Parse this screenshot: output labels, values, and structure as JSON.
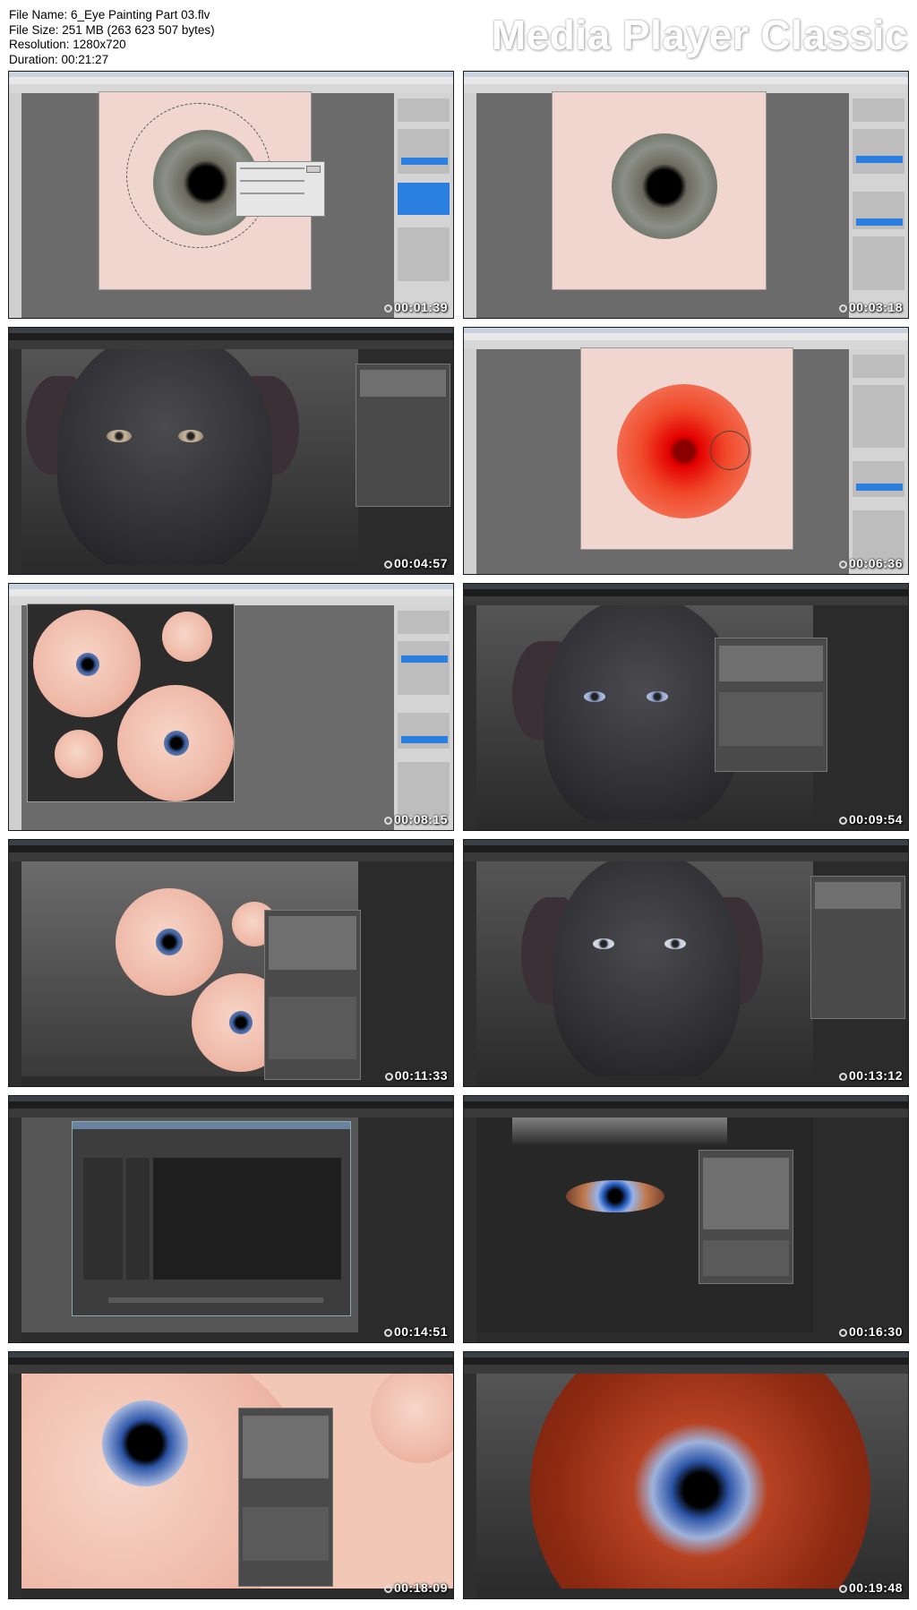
{
  "header": {
    "file_name": "File Name: 6_Eye Painting Part 03.flv",
    "file_size": "File Size: 251 MB (263 623 507 bytes)",
    "resolution": "Resolution: 1280x720",
    "duration": "Duration: 00:21:27",
    "brand": "Media Player Classic"
  },
  "thumbnails": [
    {
      "timestamp": "00:01:39"
    },
    {
      "timestamp": "00:03:18"
    },
    {
      "timestamp": "00:04:57"
    },
    {
      "timestamp": "00:06:36"
    },
    {
      "timestamp": "00:08:15"
    },
    {
      "timestamp": "00:09:54"
    },
    {
      "timestamp": "00:11:33"
    },
    {
      "timestamp": "00:13:12"
    },
    {
      "timestamp": "00:14:51"
    },
    {
      "timestamp": "00:16:30"
    },
    {
      "timestamp": "00:18:09"
    },
    {
      "timestamp": "00:19:48"
    }
  ]
}
